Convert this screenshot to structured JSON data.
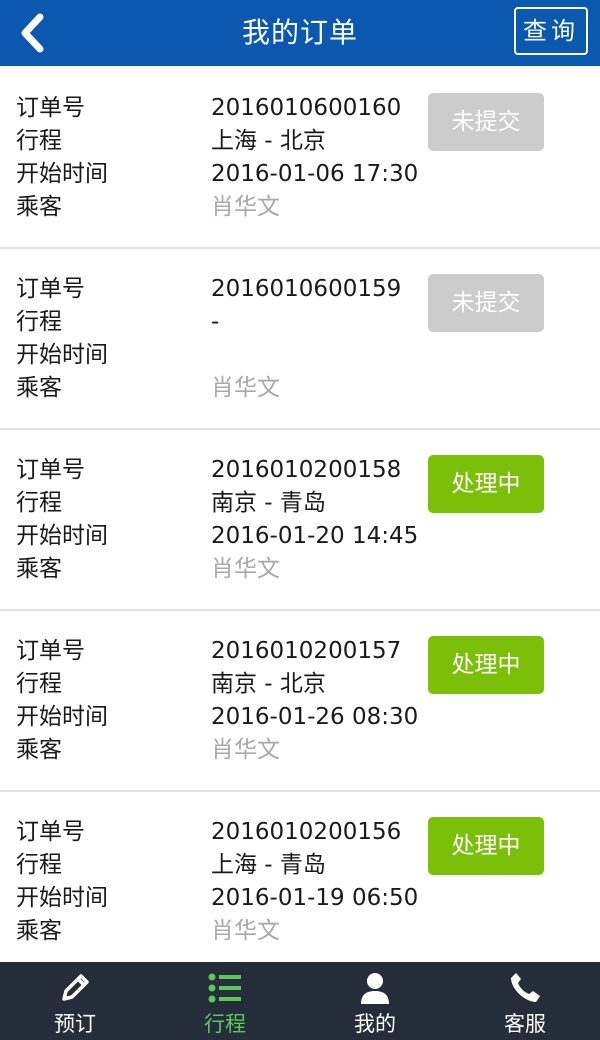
{
  "header": {
    "title": "我的订单",
    "query_label": "查询"
  },
  "labels": {
    "order_no": "订单号",
    "route": "行程",
    "start_time": "开始时间",
    "passenger": "乘客"
  },
  "orders": [
    {
      "order_no": "2016010600160",
      "route": "上海 - 北京",
      "start_time": "2016-01-06 17:30",
      "passenger": "肖华文",
      "status": "未提交"
    },
    {
      "order_no": "2016010600159",
      "route": "-",
      "start_time": "",
      "passenger": "肖华文",
      "status": "未提交"
    },
    {
      "order_no": "2016010200158",
      "route": "南京 - 青岛",
      "start_time": "2016-01-20 14:45",
      "passenger": "肖华文",
      "status": "处理中"
    },
    {
      "order_no": "2016010200157",
      "route": "南京 - 北京",
      "start_time": "2016-01-26 08:30",
      "passenger": "肖华文",
      "status": "处理中"
    },
    {
      "order_no": "2016010200156",
      "route": "上海 - 青岛",
      "start_time": "2016-01-19 06:50",
      "passenger": "肖华文",
      "status": "处理中"
    }
  ],
  "tabs": [
    {
      "label": "预订",
      "icon": "pencil-icon"
    },
    {
      "label": "行程",
      "icon": "list-icon",
      "active": true
    },
    {
      "label": "我的",
      "icon": "user-icon"
    },
    {
      "label": "客服",
      "icon": "phone-icon"
    }
  ],
  "colors": {
    "header_bg": "#0b58b0",
    "status_pending": "#cccccc",
    "status_processing": "#7cbf08",
    "tabbar_bg": "#252d3a",
    "tab_active": "#5cc85c"
  }
}
